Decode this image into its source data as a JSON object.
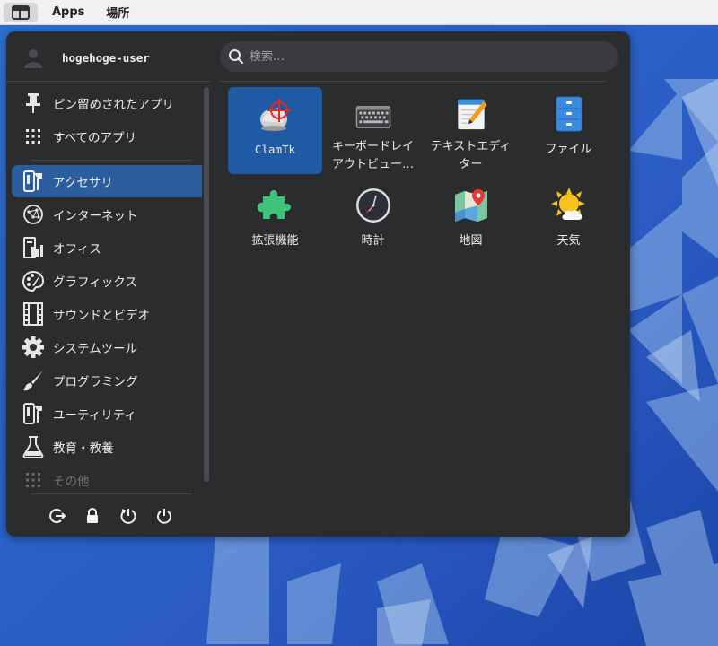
{
  "panel": {
    "apps_label": "Apps",
    "places_label": "場所"
  },
  "menu": {
    "user_name": "hogehoge-user",
    "search_placeholder": "検索…",
    "sidebar": [
      {
        "label": "ピン留めされたアプリ",
        "icon": "pin-icon"
      },
      {
        "label": "すべてのアプリ",
        "icon": "grid-icon"
      },
      {
        "label": "アクセサリ",
        "icon": "accessories-icon",
        "selected": true
      },
      {
        "label": "インターネット",
        "icon": "internet-icon"
      },
      {
        "label": "オフィス",
        "icon": "office-icon"
      },
      {
        "label": "グラフィックス",
        "icon": "graphics-icon"
      },
      {
        "label": "サウンドとビデオ",
        "icon": "film-icon"
      },
      {
        "label": "システムツール",
        "icon": "gear-icon"
      },
      {
        "label": "プログラミング",
        "icon": "brush-icon"
      },
      {
        "label": "ユーティリティ",
        "icon": "utilities-icon"
      },
      {
        "label": "教育・教養",
        "icon": "flask-icon"
      },
      {
        "label": "その他",
        "icon": "other-icon",
        "dimmed": true
      }
    ],
    "apps": [
      {
        "label": "ClamTk",
        "icon": "clamtk-icon",
        "selected": true
      },
      {
        "label": "キーボードレイ\nアウトビュー…",
        "icon": "keyboard-icon"
      },
      {
        "label": "テキストエディ\nター",
        "icon": "text-editor-icon"
      },
      {
        "label": "ファイル",
        "icon": "file-cabinet-icon"
      },
      {
        "label": "拡張機能",
        "icon": "puzzle-icon"
      },
      {
        "label": "時計",
        "icon": "clock-icon"
      },
      {
        "label": "地図",
        "icon": "map-icon"
      },
      {
        "label": "天気",
        "icon": "weather-icon"
      }
    ],
    "bottom_buttons": [
      "logout-icon",
      "lock-icon",
      "restart-icon",
      "power-icon"
    ]
  },
  "colors": {
    "accent": "#1f5aa4",
    "menu_bg": "#2b2c2e",
    "panel_bg": "#f1f1f1"
  }
}
